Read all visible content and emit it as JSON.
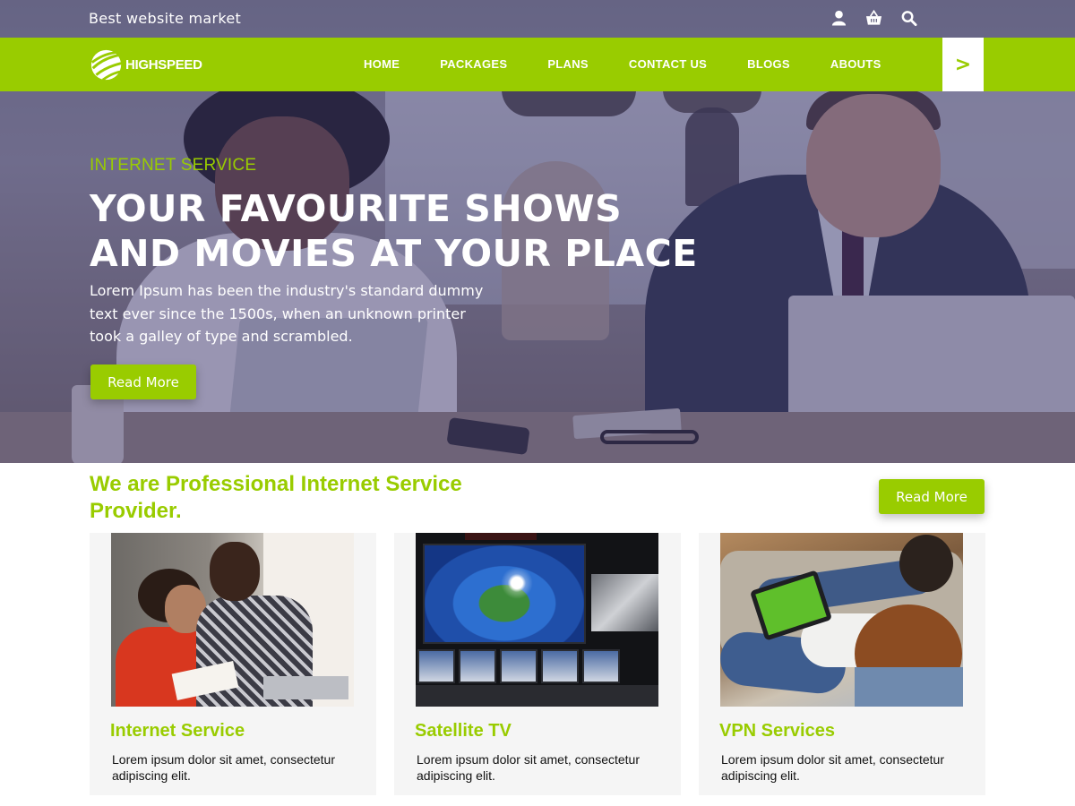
{
  "topbar": {
    "tagline": "Best website market",
    "icons": [
      "user-icon",
      "basket-icon",
      "search-icon"
    ]
  },
  "brand": {
    "logo_text": "HIGHSPEED",
    "accent_color": "#99cc00"
  },
  "nav": {
    "items": [
      {
        "label": "HOME"
      },
      {
        "label": "PACKAGES"
      },
      {
        "label": "PLANS"
      },
      {
        "label": "CONTACT US"
      },
      {
        "label": "BLOGS"
      },
      {
        "label": "ABOUTS"
      }
    ],
    "arrow": ">"
  },
  "hero": {
    "eyebrow": "INTERNET SERVICE",
    "title_line1": "YOUR FAVOURITE SHOWS",
    "title_line2": "AND MOVIES AT YOUR PLACE",
    "description": "Lorem Ipsum has been the industry's standard dummy text ever since the 1500s, when an unknown printer took a galley of type and scrambled.",
    "button": "Read More"
  },
  "about": {
    "heading": "We are Professional Internet Service Provider.",
    "button": "Read More"
  },
  "services": [
    {
      "title": "Internet Service",
      "text": "Lorem ipsum dolor sit amet, consectetur adipiscing elit."
    },
    {
      "title": "Satellite TV",
      "text": "Lorem ipsum dolor sit amet, consectetur adipiscing elit."
    },
    {
      "title": "VPN Services",
      "text": "Lorem ipsum dolor sit amet, consectetur adipiscing elit."
    }
  ]
}
